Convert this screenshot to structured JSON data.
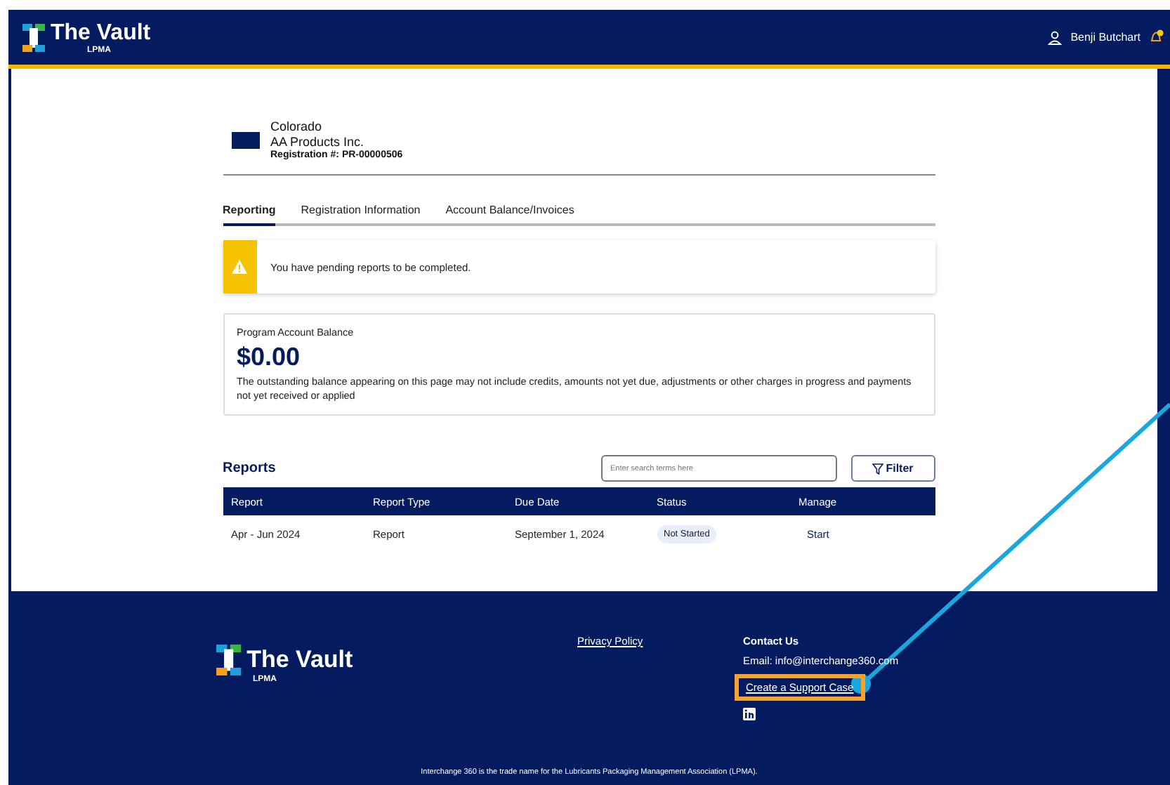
{
  "header": {
    "brand": "The Vault",
    "brand_sub": "LPMA",
    "user": "Benji Butchart",
    "notification": true
  },
  "account": {
    "state": "Colorado",
    "company": "AA Products Inc.",
    "registration": "Registration #: PR-00000506"
  },
  "tabs": [
    {
      "label": "Reporting",
      "selected": true
    },
    {
      "label": "Registration Information",
      "selected": false
    },
    {
      "label": "Account Balance/Invoices",
      "selected": false
    }
  ],
  "alert": {
    "text": "You have pending reports to be completed."
  },
  "balance": {
    "label": "Program Account Balance",
    "amount": "$0.00",
    "note": "The outstanding balance appearing on this page may not include credits, amounts not yet due, adjustments or other charges in progress and payments not yet received or applied"
  },
  "reports": {
    "title": "Reports",
    "search": {
      "placeholder": "Enter search terms here"
    },
    "filter": "Filter",
    "columns": [
      "Report",
      "Report Type",
      "Due Date",
      "Status",
      "Manage"
    ],
    "rows": [
      {
        "report": "Apr  - Jun 2024",
        "type": "Report",
        "due": "September 1, 2024",
        "status": "Not Started",
        "action": "Start"
      }
    ]
  },
  "footer": {
    "brand": "The Vault",
    "brand_sub": "LPMA",
    "privacy": "Privacy Policy",
    "contact_title": "Contact Us",
    "email": "Email: info@interchange360.com",
    "support_link": {
      "label": "Create a Support Case",
      "highlighted": true
    },
    "legal": "Interchange 360 is the trade name for the Lubricants Packaging Management Association (LPMA)."
  }
}
